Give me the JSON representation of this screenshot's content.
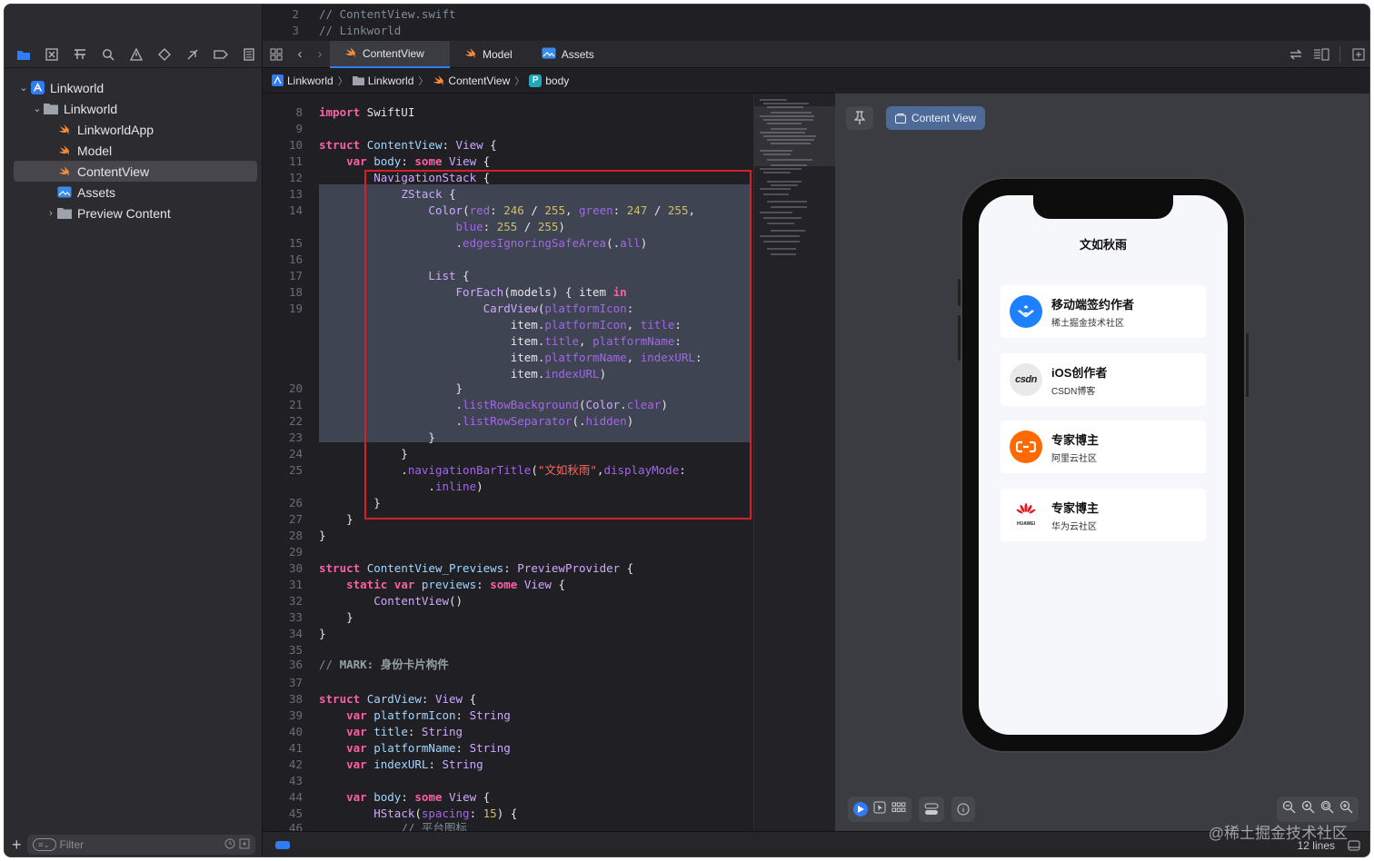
{
  "top_code": {
    "lines": [
      {
        "n": "2",
        "t": "//  ContentView.swift"
      },
      {
        "n": "3",
        "t": "//  Linkworld"
      }
    ]
  },
  "tabs": [
    {
      "label": "ContentView",
      "icon": "swift-icon",
      "active": true
    },
    {
      "label": "Model",
      "icon": "swift-icon",
      "active": false
    },
    {
      "label": "Assets",
      "icon": "assets-icon",
      "active": false
    }
  ],
  "breadcrumb": [
    "Linkworld",
    "Linkworld",
    "ContentView",
    "body"
  ],
  "breadcrumb_p": "P",
  "tree": [
    {
      "label": "Linkworld",
      "icon": "project-icon",
      "level": 0,
      "disclosure": "down"
    },
    {
      "label": "Linkworld",
      "icon": "folder-icon",
      "level": 1,
      "disclosure": "down"
    },
    {
      "label": "LinkworldApp",
      "icon": "swift-icon",
      "level": 2,
      "disclosure": ""
    },
    {
      "label": "Model",
      "icon": "swift-icon",
      "level": 2,
      "disclosure": ""
    },
    {
      "label": "ContentView",
      "icon": "swift-icon",
      "level": 2,
      "disclosure": "",
      "selected": true
    },
    {
      "label": "Assets",
      "icon": "assets-icon",
      "level": 2,
      "disclosure": ""
    },
    {
      "label": "Preview Content",
      "icon": "folder-icon",
      "level": 2,
      "disclosure": "right"
    }
  ],
  "filter": {
    "placeholder": "Filter"
  },
  "gutter": [
    "8",
    "9",
    "10",
    "11",
    "12",
    "13",
    "14",
    "",
    "15",
    "16",
    "17",
    "18",
    "19",
    "",
    "",
    "",
    "",
    "20",
    "21",
    "22",
    "23",
    "24",
    "25",
    "",
    "26",
    "27",
    "28",
    "29",
    "30",
    "31",
    "32",
    "33",
    "34",
    "35",
    "36",
    "37",
    "38",
    "39",
    "40",
    "41",
    "42",
    "43",
    "44",
    "45",
    "46"
  ],
  "preview": {
    "badge": "Content View",
    "nav_title": "文如秋雨",
    "cards": [
      {
        "title": "移动端签约作者",
        "sub": "稀土掘金技术社区",
        "logo": "juejin-logo",
        "color": "#1e80ff"
      },
      {
        "title": "iOS创作者",
        "sub": "CSDN博客",
        "logo": "csdn-logo",
        "logo_text": "csdn",
        "color": "#e9e9e9"
      },
      {
        "title": "专家博主",
        "sub": "阿里云社区",
        "logo": "aliyun-logo",
        "color": "#ff6a00"
      },
      {
        "title": "专家博主",
        "sub": "华为云社区",
        "logo": "huawei-logo",
        "logo_text": "HUAWEI",
        "color": "#ffffff"
      }
    ]
  },
  "status": {
    "lines": "12 lines"
  },
  "watermark": "@稀土掘金技术社区"
}
